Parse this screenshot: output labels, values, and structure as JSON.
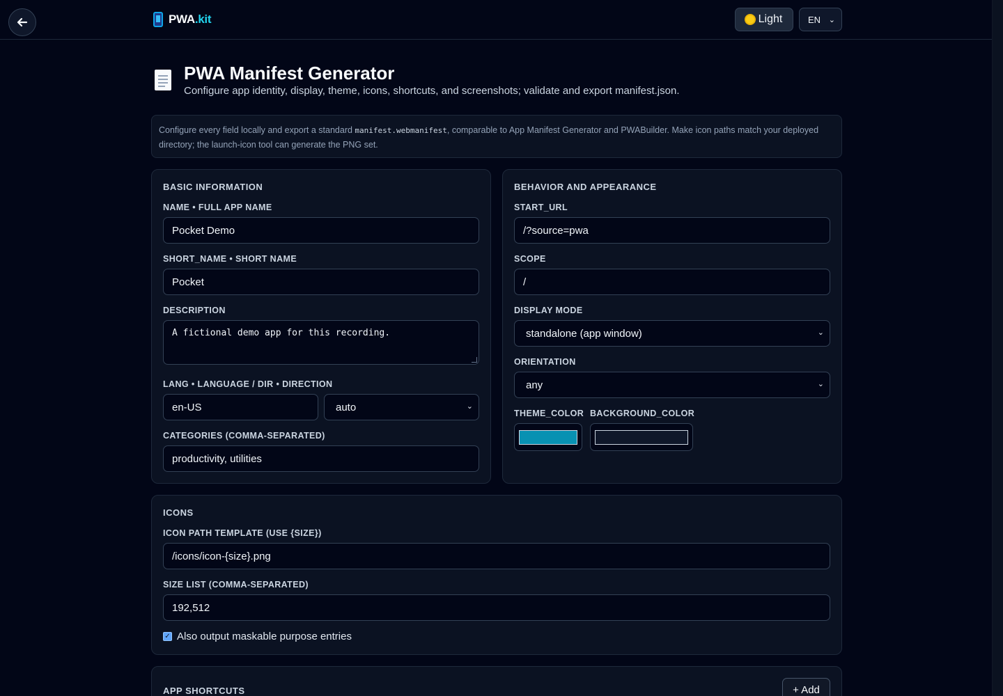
{
  "header": {
    "brand_primary": "PWA",
    "brand_accent": ".kit",
    "theme_label": "Light",
    "language": "EN"
  },
  "page": {
    "title": "PWA Manifest Generator",
    "subtitle": "Configure app identity, display, theme, icons, shortcuts, and screenshots; validate and export manifest.json."
  },
  "info": {
    "before": "Configure every field locally and export a standard ",
    "code": "manifest.webmanifest",
    "after": ", comparable to App Manifest Generator and PWABuilder. Make icon paths match your deployed directory; the launch-icon tool can generate the PNG set."
  },
  "basic": {
    "title": "Basic Information",
    "name_label": "NAME • Full app name",
    "name_value": "Pocket Demo",
    "short_name_label": "SHORT_NAME • Short name",
    "short_name_value": "Pocket",
    "description_label": "DESCRIPTION",
    "description_value": "A fictional demo app for this recording.",
    "lang_label": "LANG • Language / DIR • Direction",
    "lang_value": "en-US",
    "dir_value": "auto",
    "categories_label": "Categories (comma-separated)",
    "categories_value": "productivity, utilities"
  },
  "behavior": {
    "title": "Behavior and Appearance",
    "start_url_label": "START_URL",
    "start_url_value": "/?source=pwa",
    "scope_label": "SCOPE",
    "scope_value": "/",
    "display_label": "Display mode",
    "display_value": "standalone (app window)",
    "orientation_label": "Orientation",
    "orientation_value": "any",
    "theme_color_label": "THEME_COLOR",
    "theme_color": "#0891b2",
    "background_color_label": "BACKGROUND_COLOR",
    "background_color": "#0f172a"
  },
  "icons": {
    "title": "Icons",
    "path_label": "Icon path template (use {size})",
    "path_value": "/icons/icon-{size}.png",
    "sizes_label": "Size list (comma-separated)",
    "sizes_value": "192,512",
    "maskable_label": "Also output maskable purpose entries",
    "maskable_checked": true
  },
  "shortcuts": {
    "title": "App Shortcuts",
    "add_label": "+ Add"
  }
}
